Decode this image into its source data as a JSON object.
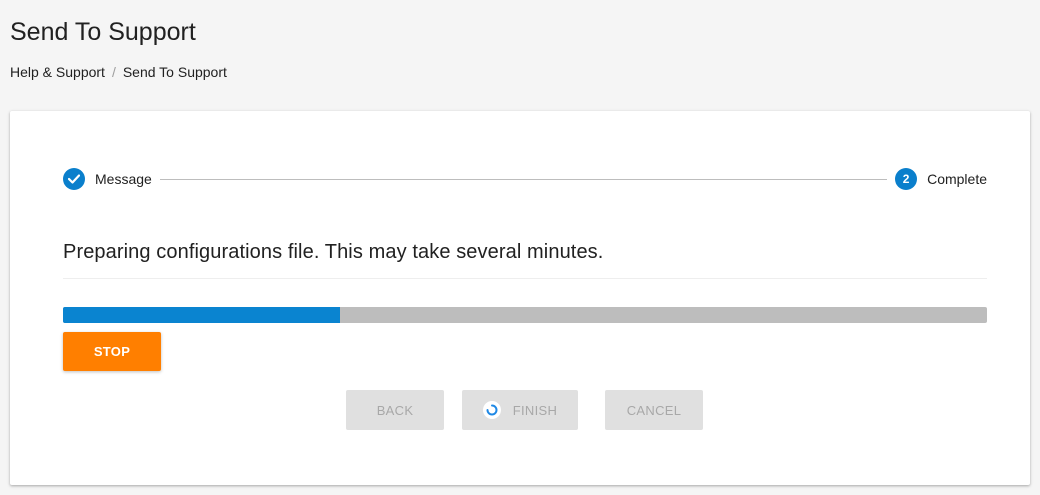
{
  "page": {
    "title": "Send To Support"
  },
  "breadcrumb": {
    "items": [
      "Help & Support",
      "Send To Support"
    ],
    "separator": "/"
  },
  "stepper": {
    "steps": [
      {
        "label": "Message",
        "state": "completed",
        "icon": "check-icon"
      },
      {
        "label": "Complete",
        "state": "active",
        "number": "2"
      }
    ]
  },
  "content": {
    "message": "Preparing configurations file. This may take several minutes.",
    "progress_fraction": 0.3
  },
  "buttons": {
    "stop": "STOP",
    "back": "BACK",
    "finish": "FINISH",
    "cancel": "CANCEL"
  },
  "colors": {
    "accent": "#0a7fcc",
    "stop_button": "#ff7f00",
    "disabled_button": "#e0e0e0"
  }
}
